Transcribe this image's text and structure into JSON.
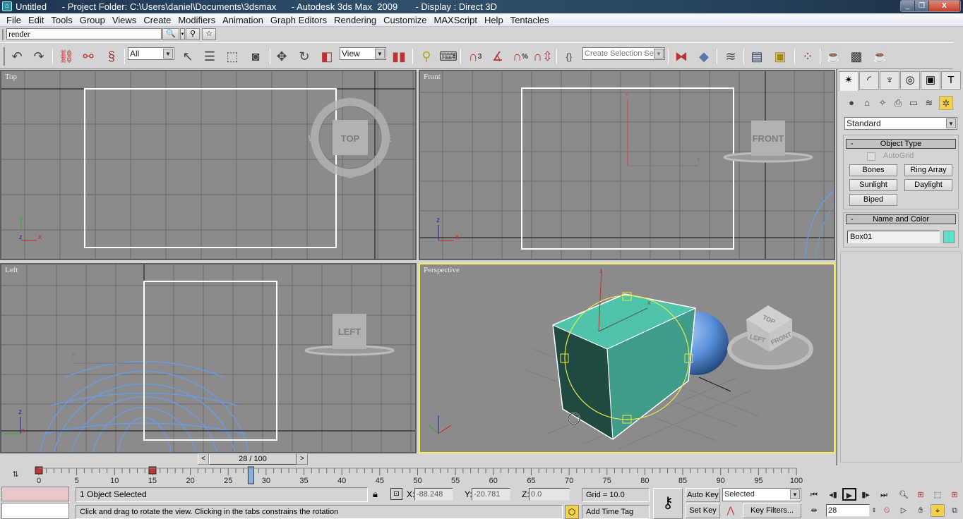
{
  "window": {
    "title": "Untitled      - Project Folder: C:\\Users\\daniel\\Documents\\3dsmax      - Autodesk 3ds Max  2009       - Display : Direct 3D",
    "app_icon": "3dsmax-icon",
    "controls": {
      "minimize": "_",
      "restore": "❐",
      "close": "X"
    }
  },
  "menu": [
    "File",
    "Edit",
    "Tools",
    "Group",
    "Views",
    "Create",
    "Modifiers",
    "Animation",
    "Graph Editors",
    "Rendering",
    "Customize",
    "MAXScript",
    "Help",
    "Tentacles"
  ],
  "search": {
    "value": "render",
    "search_icon": "🔍",
    "filter_icon": "⚲",
    "favorite_icon": "☆"
  },
  "toolbar": {
    "selection_filter": "All",
    "ref_coord": "View",
    "named_selection_placeholder": "Create Selection Set",
    "snap_labels": {
      "snap3": "3",
      "percent": "%"
    }
  },
  "viewports": [
    {
      "label": "Top",
      "viewcube": "TOP",
      "compass": {
        "n": "N",
        "s": "S",
        "e": "E",
        "w": "W"
      },
      "axis": {
        "a": "y",
        "b": "x",
        "c": "z"
      }
    },
    {
      "label": "Front",
      "viewcube": "FRONT",
      "axis": {
        "a": "z",
        "b": "x"
      }
    },
    {
      "label": "Left",
      "viewcube": "LEFT",
      "axis": {
        "a": "z",
        "b": "x",
        "c": "y"
      }
    },
    {
      "label": "Perspective",
      "viewcube_faces": {
        "top": "TOP",
        "left": "LEFT",
        "front": "FRONT"
      },
      "active": true
    }
  ],
  "command_panel": {
    "tabs": [
      "create",
      "modify",
      "hierarchy",
      "motion",
      "display",
      "utilities"
    ],
    "category_icons": [
      "geometry",
      "shapes",
      "lights",
      "cameras",
      "helpers",
      "space-warps",
      "systems"
    ],
    "dropdown": "Standard",
    "object_type": {
      "title": "Object Type",
      "autogrid": "AutoGrid",
      "buttons": [
        "Bones",
        "Ring Array",
        "Sunlight",
        "Daylight",
        "Biped"
      ]
    },
    "name_and_color": {
      "title": "Name and Color",
      "name": "Box01",
      "color": "#5fe0c8"
    },
    "collapse_sign": "-"
  },
  "time_slider": {
    "label": "28 / 100",
    "current": 28,
    "total": 100,
    "prev": "<",
    "next": ">"
  },
  "timeline": {
    "ticks": [
      0,
      5,
      10,
      15,
      20,
      25,
      30,
      35,
      40,
      45,
      50,
      55,
      60,
      65,
      70,
      75,
      80,
      85,
      90,
      95,
      100
    ],
    "keys": [
      0,
      15
    ],
    "current": 28
  },
  "status": {
    "selection": "1 Object Selected",
    "prompt": "Click and drag to rotate the view.  Clicking in the tabs constrains the rotation",
    "x_label": "X:",
    "x": "-88.248",
    "y_label": "Y:",
    "y": "-20.781",
    "z_label": "Z:",
    "z": "0.0",
    "grid": "Grid = 10.0",
    "add_time_tag": "Add Time Tag"
  },
  "animation": {
    "auto_key": "Auto Key",
    "set_key": "Set Key",
    "key_mode": "Selected",
    "key_filters": "Key Filters...",
    "frame": "28"
  },
  "colors": {
    "viewport_bg": "#8b8b8b",
    "active_border": "#f5ef5a",
    "box_top": "#4fc4aa",
    "box_front": "#3e9c88",
    "box_side": "#1f4a42",
    "sphere": "#5b92dc"
  }
}
